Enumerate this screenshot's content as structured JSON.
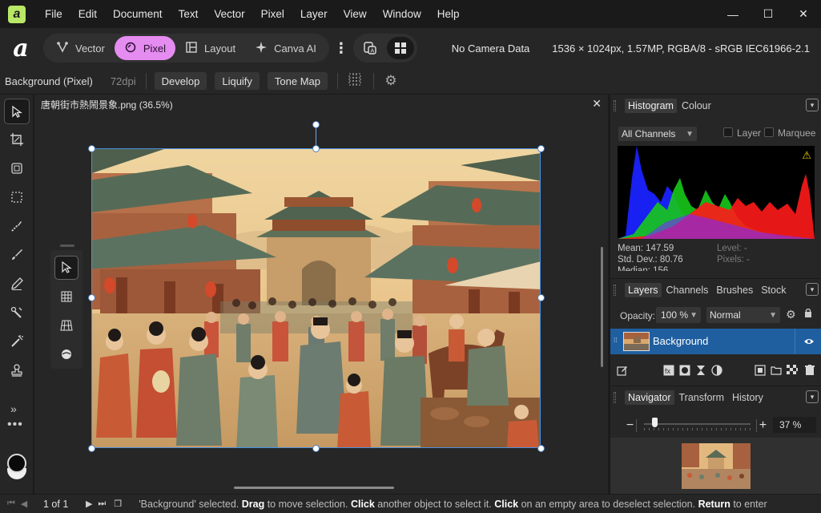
{
  "menubar": {
    "logo": "a",
    "items": [
      "File",
      "Edit",
      "Document",
      "Text",
      "Vector",
      "Pixel",
      "Layer",
      "View",
      "Window",
      "Help"
    ],
    "window_controls": {
      "minimize": "—",
      "maximize": "☐",
      "close": "✕"
    }
  },
  "toolbar": {
    "logo": "a",
    "personas": [
      {
        "label": "Vector",
        "icon": "pen-node-icon"
      },
      {
        "label": "Pixel",
        "icon": "pixel-brush-icon",
        "active": true
      },
      {
        "label": "Layout",
        "icon": "layout-icon"
      },
      {
        "label": "Canva AI",
        "icon": "sparkle-icon"
      }
    ],
    "camera_info": "No Camera Data",
    "doc_info": "1536 × 1024px, 1.57MP, RGBA/8 - sRGB IEC61966-2.1"
  },
  "contextbar": {
    "layer_label": "Background (Pixel)",
    "dpi": "72dpi",
    "buttons": [
      "Develop",
      "Liquify",
      "Tone Map"
    ]
  },
  "document": {
    "tab_title": "唐朝街市熱鬧景象.png (36.5%)",
    "close": "✕"
  },
  "histogram": {
    "tabs": [
      "Histogram",
      "Colour"
    ],
    "channel_select": "All Channels",
    "check_layer": "Layer",
    "check_marquee": "Marquee",
    "warning": "⚠",
    "stats": {
      "mean": "Mean: 147.59",
      "std_dev": "Std. Dev.: 80.76",
      "median_partial": "Median: 156",
      "level": "Level: -",
      "pixels": "Pixels: -"
    }
  },
  "layers": {
    "tabs": [
      "Layers",
      "Channels",
      "Brushes",
      "Stock"
    ],
    "opacity_label": "Opacity:",
    "opacity_value": "100 %",
    "blend_mode": "Normal",
    "rows": [
      {
        "name": "Background",
        "visible": true,
        "selected": true
      }
    ]
  },
  "navigator": {
    "tabs": [
      "Navigator",
      "Transform",
      "History"
    ],
    "zoom_value": "37 %",
    "zoom_fraction": 0.1
  },
  "statusbar": {
    "page": "1 of 1",
    "message_parts": [
      {
        "text": "'Background' selected. ",
        "bold": false
      },
      {
        "text": "Drag",
        "bold": true
      },
      {
        "text": " to move selection. ",
        "bold": false
      },
      {
        "text": "Click",
        "bold": true
      },
      {
        "text": " another object to select it. ",
        "bold": false
      },
      {
        "text": "Click",
        "bold": true
      },
      {
        "text": " on an empty area to deselect selection. ",
        "bold": false
      },
      {
        "text": "Return",
        "bold": true
      },
      {
        "text": " to enter",
        "bold": false
      }
    ]
  },
  "colors": {
    "accent_pixel": "#e58cf0",
    "selection_blue": "#1f5fa0",
    "app_logo": "#b8e866"
  }
}
